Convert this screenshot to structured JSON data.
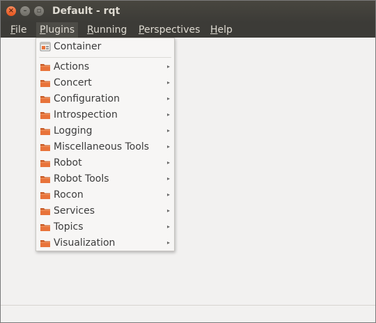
{
  "window": {
    "title": "Default - rqt"
  },
  "menubar": {
    "items": [
      {
        "label": "File",
        "mnemonic": "F",
        "rest": "ile"
      },
      {
        "label": "Plugins",
        "mnemonic": "P",
        "rest": "lugins"
      },
      {
        "label": "Running",
        "mnemonic": "R",
        "rest": "unning"
      },
      {
        "label": "Perspectives",
        "mnemonic": "P",
        "rest": "erspectives"
      },
      {
        "label": "Help",
        "mnemonic": "H",
        "rest": "elp"
      }
    ],
    "active": "Plugins"
  },
  "plugins_menu": {
    "container": {
      "label": "Container",
      "icon": "container-icon"
    },
    "submenus": [
      {
        "label": "Actions",
        "icon": "folder-icon",
        "has_submenu": true
      },
      {
        "label": "Concert",
        "icon": "folder-icon",
        "has_submenu": true
      },
      {
        "label": "Configuration",
        "icon": "folder-icon",
        "has_submenu": true
      },
      {
        "label": "Introspection",
        "icon": "folder-icon",
        "has_submenu": true
      },
      {
        "label": "Logging",
        "icon": "folder-icon",
        "has_submenu": true
      },
      {
        "label": "Miscellaneous Tools",
        "icon": "folder-icon",
        "has_submenu": true
      },
      {
        "label": "Robot",
        "icon": "folder-icon",
        "has_submenu": true
      },
      {
        "label": "Robot Tools",
        "icon": "folder-icon",
        "has_submenu": true
      },
      {
        "label": "Rocon",
        "icon": "folder-icon",
        "has_submenu": true
      },
      {
        "label": "Services",
        "icon": "folder-icon",
        "has_submenu": true
      },
      {
        "label": "Topics",
        "icon": "folder-icon",
        "has_submenu": true
      },
      {
        "label": "Visualization",
        "icon": "folder-icon",
        "has_submenu": true
      }
    ],
    "submenu_arrow": "▸"
  },
  "colors": {
    "titlebar": "#3c3b37",
    "close_button": "#e8541c",
    "folder": "#e8733a",
    "menu_background": "#f7f6f5"
  }
}
